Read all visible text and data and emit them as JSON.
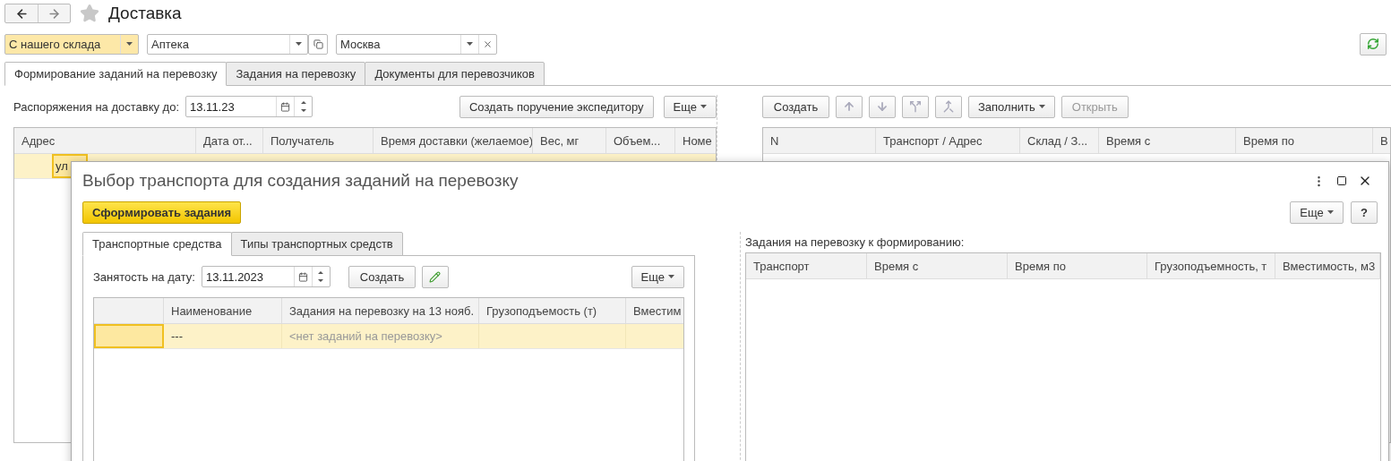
{
  "window": {
    "title": "Доставка",
    "favorite": false
  },
  "filters": [
    {
      "value": "С нашего склада",
      "highlighted": true,
      "kind": "plain"
    },
    {
      "value": "Аптека",
      "highlighted": false,
      "kind": "open"
    },
    {
      "value": "Москва",
      "highlighted": false,
      "kind": "clear"
    }
  ],
  "tabs": [
    {
      "label": "Формирование заданий на перевозку",
      "selected": true
    },
    {
      "label": "Задания на перевозку",
      "selected": false
    },
    {
      "label": "Документы для перевозчиков",
      "selected": false
    }
  ],
  "left_panel": {
    "date_label": "Распоряжения на доставку до:",
    "date": "13.11.23",
    "buttons": [
      {
        "label": "Создать поручение экспедитору",
        "dropdown": false
      },
      {
        "label": "Еще",
        "dropdown": true
      }
    ],
    "table": {
      "columns": [
        "Адрес",
        "Дата от...",
        "Получатель",
        "Время доставки (желаемое)",
        "Вес, мг",
        "Объем...",
        "Номе"
      ],
      "rows": [
        {
          "selected": true,
          "address": "ул"
        }
      ]
    }
  },
  "right_panel": {
    "buttons": [
      {
        "kind": "text",
        "label": "Создать",
        "disabled": false
      },
      {
        "kind": "up",
        "disabled": true
      },
      {
        "kind": "down",
        "disabled": true
      },
      {
        "kind": "split",
        "disabled": true
      },
      {
        "kind": "merge",
        "disabled": true
      },
      {
        "kind": "menu",
        "label": "Заполнить",
        "disabled": false
      },
      {
        "kind": "text",
        "label": "Открыть",
        "disabled": true
      }
    ],
    "table": {
      "columns": [
        "N",
        "Транспорт / Адрес",
        "Склад / З...",
        "Время с",
        "Время по",
        "В"
      ]
    }
  },
  "dialog": {
    "title": "Выбор транспорта для создания заданий на перевозку",
    "primary_button": "Сформировать задания",
    "buttons": [
      {
        "kind": "menu",
        "label": "Еще"
      },
      {
        "kind": "help",
        "label": "?"
      }
    ],
    "tabs": [
      {
        "label": "Транспортные средства",
        "selected": true
      },
      {
        "label": "Типы транспортных средств",
        "selected": false
      }
    ],
    "date_label": "Занятость на дату:",
    "date": "13.11.2023",
    "toolbar": [
      {
        "kind": "text",
        "label": "Создать"
      },
      {
        "kind": "edit"
      }
    ],
    "more_button": "Еще",
    "vehicles_table": {
      "columns": [
        "Наименование",
        "Задания на перевозку на 13 нояб.",
        "Грузоподъемость (т)",
        "Вместим"
      ],
      "rows": [
        {
          "selected": true,
          "name": "---",
          "tasks": "<нет заданий на перевозку>",
          "placeholder": true
        }
      ]
    },
    "tasks_label": "Задания на перевозку к формированию:",
    "tasks_table": {
      "columns": [
        "Транспорт",
        "Время с",
        "Время по",
        "Грузоподъемность, т",
        "Вместимость, м3"
      ]
    }
  }
}
